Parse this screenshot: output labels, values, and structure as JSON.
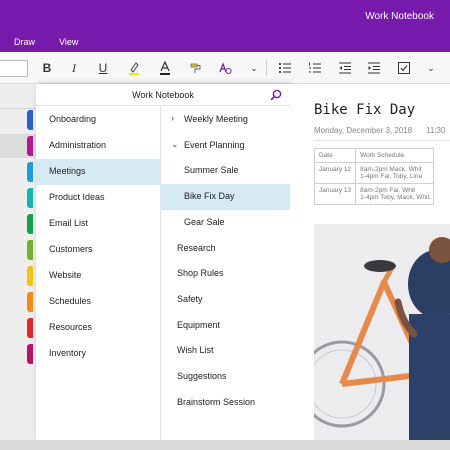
{
  "window": {
    "title": "Work Notebook"
  },
  "menu": {
    "tabs": [
      "Draw",
      "View"
    ]
  },
  "toolbar": {
    "icons": [
      "bold-icon",
      "italic-icon",
      "underline-icon",
      "highlighter-icon",
      "font-color-icon",
      "format-painter-icon",
      "clear-format-icon",
      "more-chevron-icon",
      "bullets-icon",
      "numbering-icon",
      "outdent-icon",
      "indent-icon",
      "todo-checkbox-icon",
      "more-chevron-icon"
    ],
    "bold": "B",
    "italic": "I",
    "underline": "U"
  },
  "notebook": {
    "name": "Work Notebook",
    "sections": [
      {
        "label": "Onboarding",
        "color": "#2a62c9"
      },
      {
        "label": "Administration",
        "color": "#b3178f"
      },
      {
        "label": "Meetings",
        "color": "#1aa0d6",
        "active": true
      },
      {
        "label": "Product Ideas",
        "color": "#11b5b0"
      },
      {
        "label": "Email List",
        "color": "#12a34a"
      },
      {
        "label": "Customers",
        "color": "#72b32a"
      },
      {
        "label": "Website",
        "color": "#f3c513"
      },
      {
        "label": "Schedules",
        "color": "#f08c13"
      },
      {
        "label": "Resources",
        "color": "#e0282c"
      },
      {
        "label": "Inventory",
        "color": "#b5156f"
      }
    ],
    "pages": [
      {
        "label": "Weekly Meeting",
        "chevron": ">",
        "level": 0
      },
      {
        "label": "Event Planning",
        "chevron": "v",
        "level": 0
      },
      {
        "label": "Summer Sale",
        "level": 1
      },
      {
        "label": "Bike Fix Day",
        "level": 1,
        "active": true
      },
      {
        "label": "Gear Sale",
        "level": 1
      },
      {
        "label": "Research",
        "level": 0
      },
      {
        "label": "Shop Rules",
        "level": 0
      },
      {
        "label": "Safety",
        "level": 0
      },
      {
        "label": "Equipment",
        "level": 0
      },
      {
        "label": "Wish List",
        "level": 0
      },
      {
        "label": "Suggestions",
        "level": 0
      },
      {
        "label": "Brainstorm Session",
        "level": 0
      }
    ]
  },
  "page": {
    "title": "Bike Fix Day",
    "date": "Monday, December 3, 2018",
    "time": "11:30",
    "table": {
      "headers": [
        "Date",
        "Work Schedule"
      ],
      "rows": [
        {
          "date": "January 12",
          "lines": [
            "8am-2pm Mack, Whit",
            "1-4pm Fai, Toby, Lina"
          ]
        },
        {
          "date": "January 13",
          "lines": [
            "8am-2pm Fai, Whit",
            "1-4pm Toby, Mack, Whit"
          ]
        }
      ]
    }
  },
  "colors": {
    "brand": "#7719aa",
    "selection": "#d6eaf5",
    "bike_frame": "#e58a4a"
  }
}
